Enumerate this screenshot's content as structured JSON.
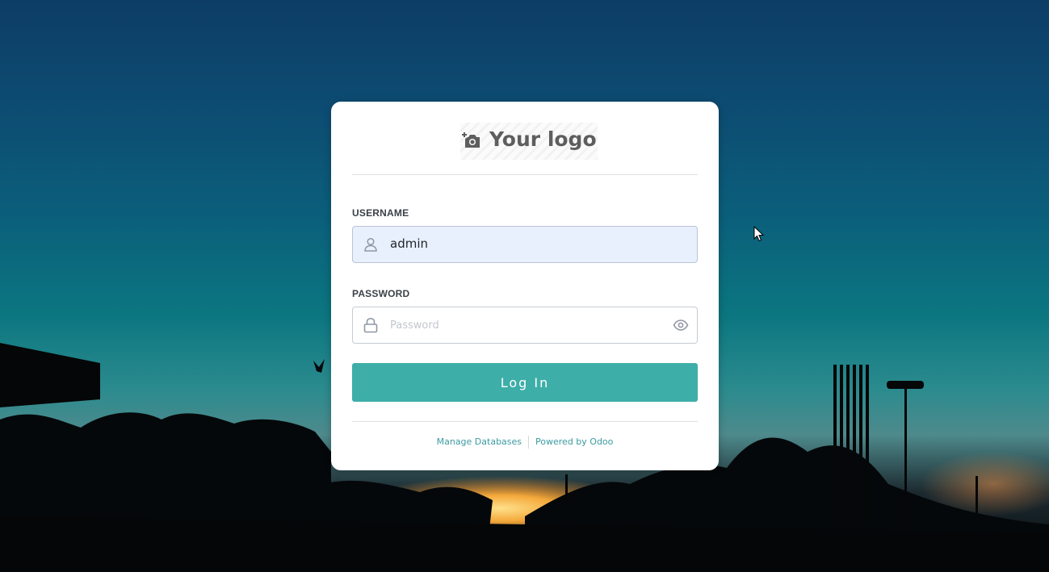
{
  "logo": {
    "icon": "camera-plus-icon",
    "text": "Your logo"
  },
  "form": {
    "username_label": "USERNAME",
    "username_value": "admin",
    "username_icon": "user-icon",
    "password_label": "PASSWORD",
    "password_placeholder": "Password",
    "password_icon": "lock-icon",
    "reveal_icon": "eye-icon",
    "login_label": "Log In"
  },
  "footer": {
    "manage_databases": "Manage Databases",
    "powered_by": "Powered by Odoo"
  },
  "colors": {
    "accent": "#3eaea9",
    "link": "#3c9aa0",
    "autofill_bg": "#e8f0fe"
  }
}
